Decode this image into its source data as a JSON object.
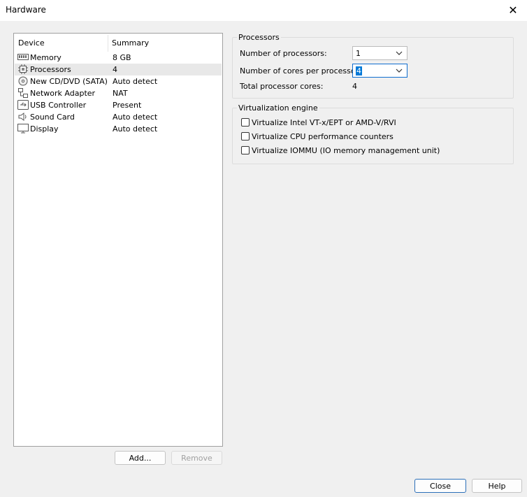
{
  "window": {
    "title": "Hardware"
  },
  "device_list": {
    "headers": {
      "device": "Device",
      "summary": "Summary"
    },
    "items": [
      {
        "name": "Memory",
        "summary": "8 GB",
        "icon": "memory-icon"
      },
      {
        "name": "Processors",
        "summary": "4",
        "icon": "processor-icon",
        "selected": true
      },
      {
        "name": "New CD/DVD (SATA)",
        "summary": "Auto detect",
        "icon": "cd-dvd-icon"
      },
      {
        "name": "Network Adapter",
        "summary": "NAT",
        "icon": "network-adapter-icon"
      },
      {
        "name": "USB Controller",
        "summary": "Present",
        "icon": "usb-icon"
      },
      {
        "name": "Sound Card",
        "summary": "Auto detect",
        "icon": "sound-card-icon"
      },
      {
        "name": "Display",
        "summary": "Auto detect",
        "icon": "display-icon"
      }
    ],
    "add_label": "Add...",
    "remove_label": "Remove"
  },
  "processors": {
    "title": "Processors",
    "num_processors_label": "Number of processors:",
    "num_processors_value": "1",
    "cores_label": "Number of cores per processor:",
    "cores_value": "4",
    "total_label": "Total processor cores:",
    "total_value": "4"
  },
  "virtualization": {
    "title": "Virtualization engine",
    "options": [
      {
        "label": "Virtualize Intel VT-x/EPT or AMD-V/RVI",
        "checked": false
      },
      {
        "label": "Virtualize CPU performance counters",
        "checked": false
      },
      {
        "label": "Virtualize IOMMU (IO memory management unit)",
        "checked": false
      }
    ]
  },
  "footer": {
    "close_label": "Close",
    "help_label": "Help"
  },
  "colors": {
    "accent": "#0078d7",
    "selection": "#e8e8e8"
  }
}
